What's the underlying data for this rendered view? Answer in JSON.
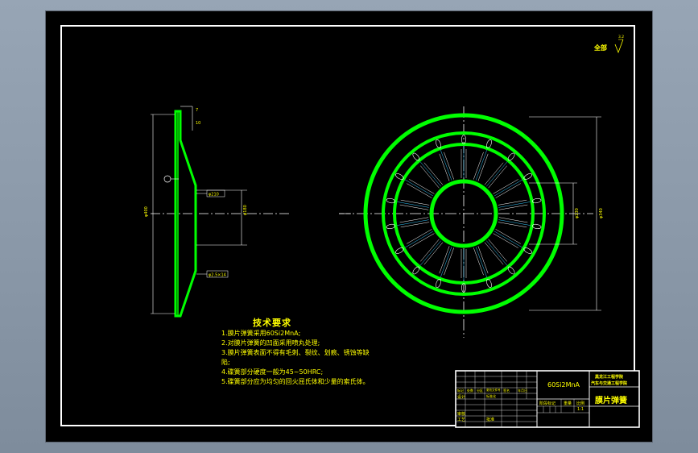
{
  "drawing": {
    "corner_note": "全部",
    "corner_roughness": "3.2",
    "side_view_labels": [
      "7",
      "10",
      "φ400",
      "φ180",
      "φ210",
      "φ2.5×14"
    ],
    "front_view_labels": [
      "φ230",
      "φ340"
    ]
  },
  "technical_requirements": {
    "title": "技术要求",
    "lines": [
      "1.膜片弹簧采用60Si2MnA;",
      "2.对膜片弹簧的凹面采用喷丸处理;",
      "3.膜片弹簧表面不得有毛刺、裂纹、划痕、锈蚀等缺",
      "陷;",
      "4.碟簧部分硬度一般为45~50HRC;",
      "5.碟簧部分应为均匀的回火屈氏体和少量的索氏体。"
    ]
  },
  "title_block": {
    "material": "60Si2MnA",
    "school_line1": "黑龙江工程学院",
    "school_line2": "汽车与交通工程学院",
    "part_name": "膜片弹簧",
    "stage_label": "阶段标记",
    "weight_label": "重量",
    "scale_label": "比例",
    "scale_value": "1:1",
    "design_label": "设计",
    "review_label": "审核",
    "process_label": "工艺",
    "standard_label": "标准化",
    "approve_label": "批准",
    "mark_label": "标记",
    "count_label": "处数",
    "zone_label": "分区",
    "change_doc_label": "更改文件号",
    "sign_label": "签名",
    "date_label": "年月日"
  }
}
